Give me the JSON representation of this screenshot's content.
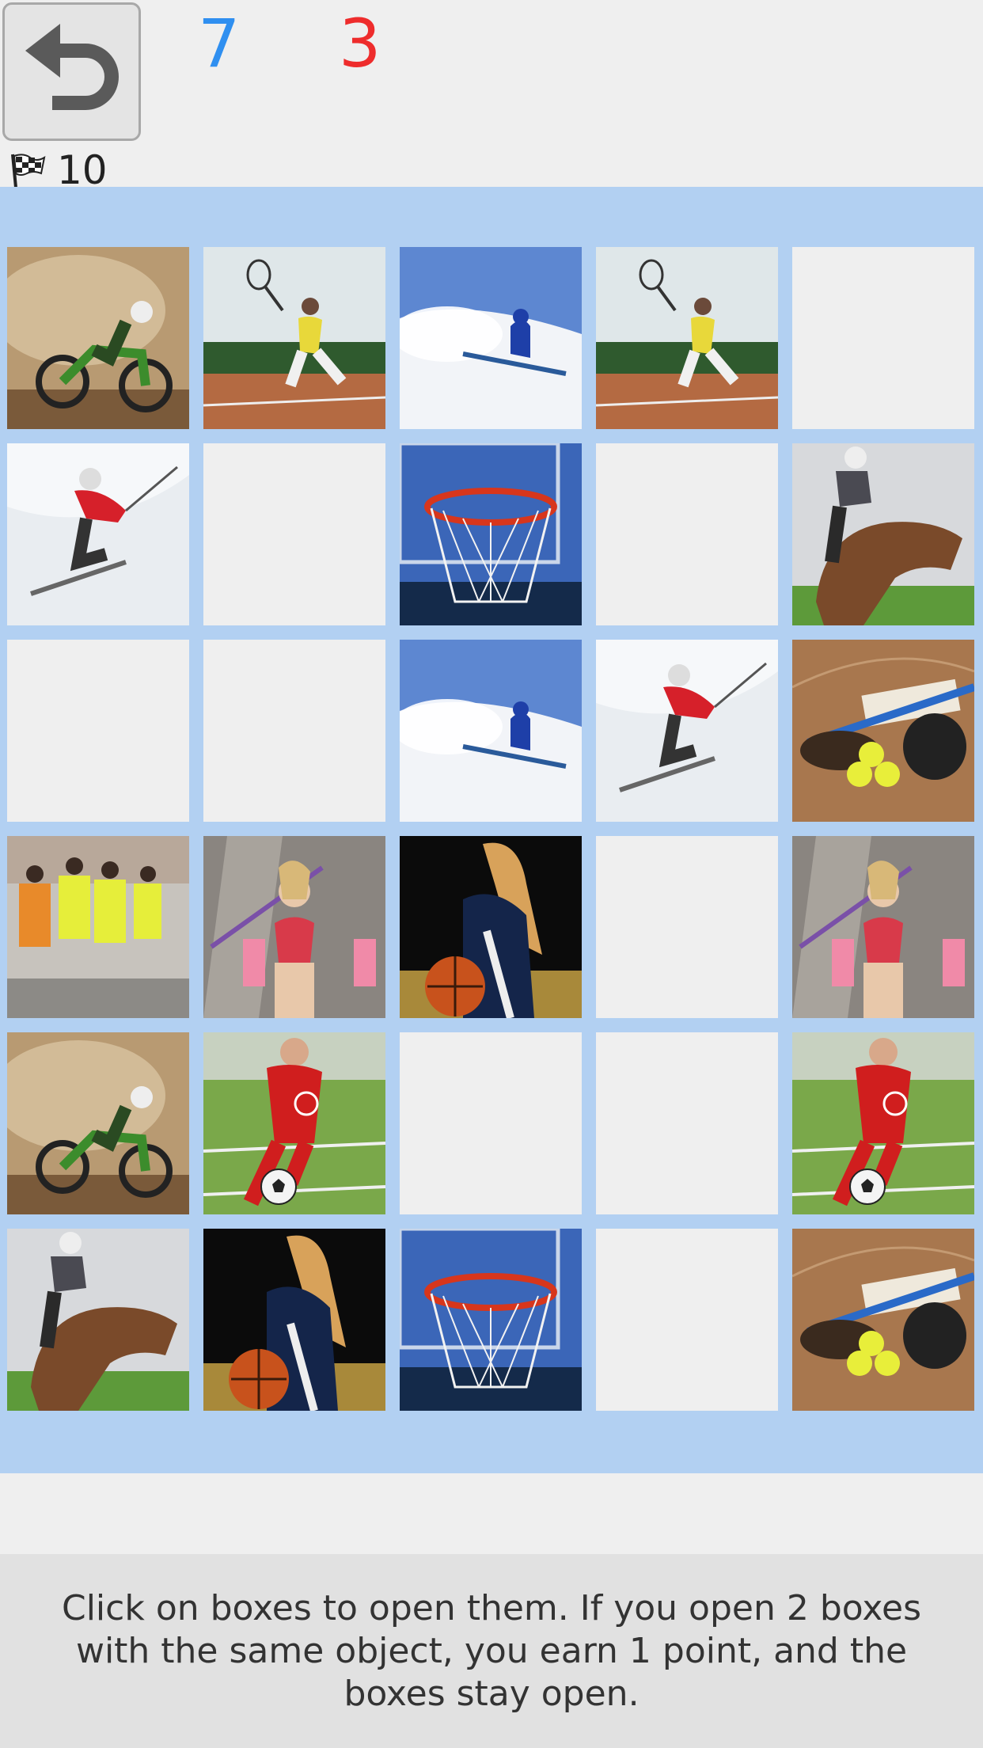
{
  "header": {
    "undo_icon": "undo-arrow-icon",
    "player1_score": "7",
    "player2_score": "3",
    "player1_color": "#2f8ff0",
    "player2_color": "#ee2c2c",
    "moves_icon": "checkered-flag-icon",
    "moves_count": "10"
  },
  "board": {
    "background": "#b2d0f2",
    "rows": [
      [
        "motocross",
        "tennis",
        "ski-blue",
        "tennis",
        "closed"
      ],
      [
        "ski-red",
        "closed",
        "basketball-hoop",
        "closed",
        "horse-racing"
      ],
      [
        "closed",
        "closed",
        "ski-blue",
        "ski-red",
        "softball"
      ],
      [
        "marathon",
        "fitness",
        "basketball-player",
        "closed",
        "fitness"
      ],
      [
        "motocross",
        "soccer",
        "closed",
        "closed",
        "soccer"
      ],
      [
        "horse-racing",
        "basketball-player",
        "basketball-hoop",
        "closed",
        "softball"
      ]
    ]
  },
  "instructions": "Click on boxes to open them. If you open 2 boxes with the same object, you earn 1 point, and the boxes stay open."
}
